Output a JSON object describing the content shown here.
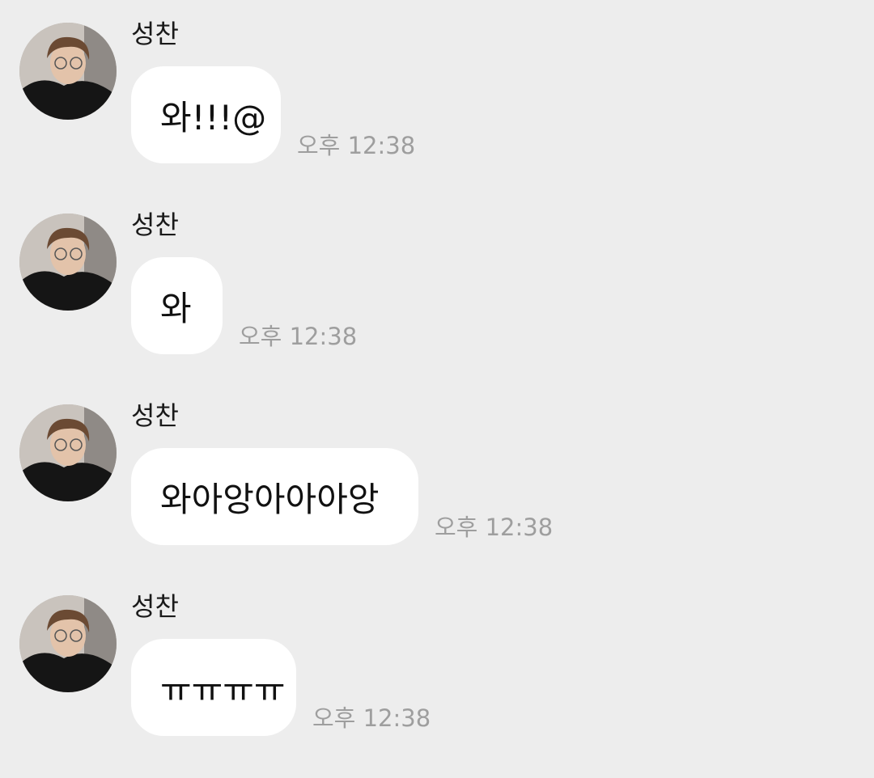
{
  "colors": {
    "background": "#ededed",
    "bubble": "#ffffff",
    "time_text": "#9e9e9e",
    "name_text": "#1a1a1a"
  },
  "messages": [
    {
      "sender": "성찬",
      "text": "와!!!@",
      "time": "오후 12:38",
      "avatar_icon": "profile-photo"
    },
    {
      "sender": "성찬",
      "text": "와",
      "time": "오후 12:38",
      "avatar_icon": "profile-photo"
    },
    {
      "sender": "성찬",
      "text": "와아앙아아아앙",
      "time": "오후 12:38",
      "avatar_icon": "profile-photo"
    },
    {
      "sender": "성찬",
      "text": "ㅠㅠㅠㅠ",
      "time": "오후 12:38",
      "avatar_icon": "profile-photo"
    }
  ]
}
